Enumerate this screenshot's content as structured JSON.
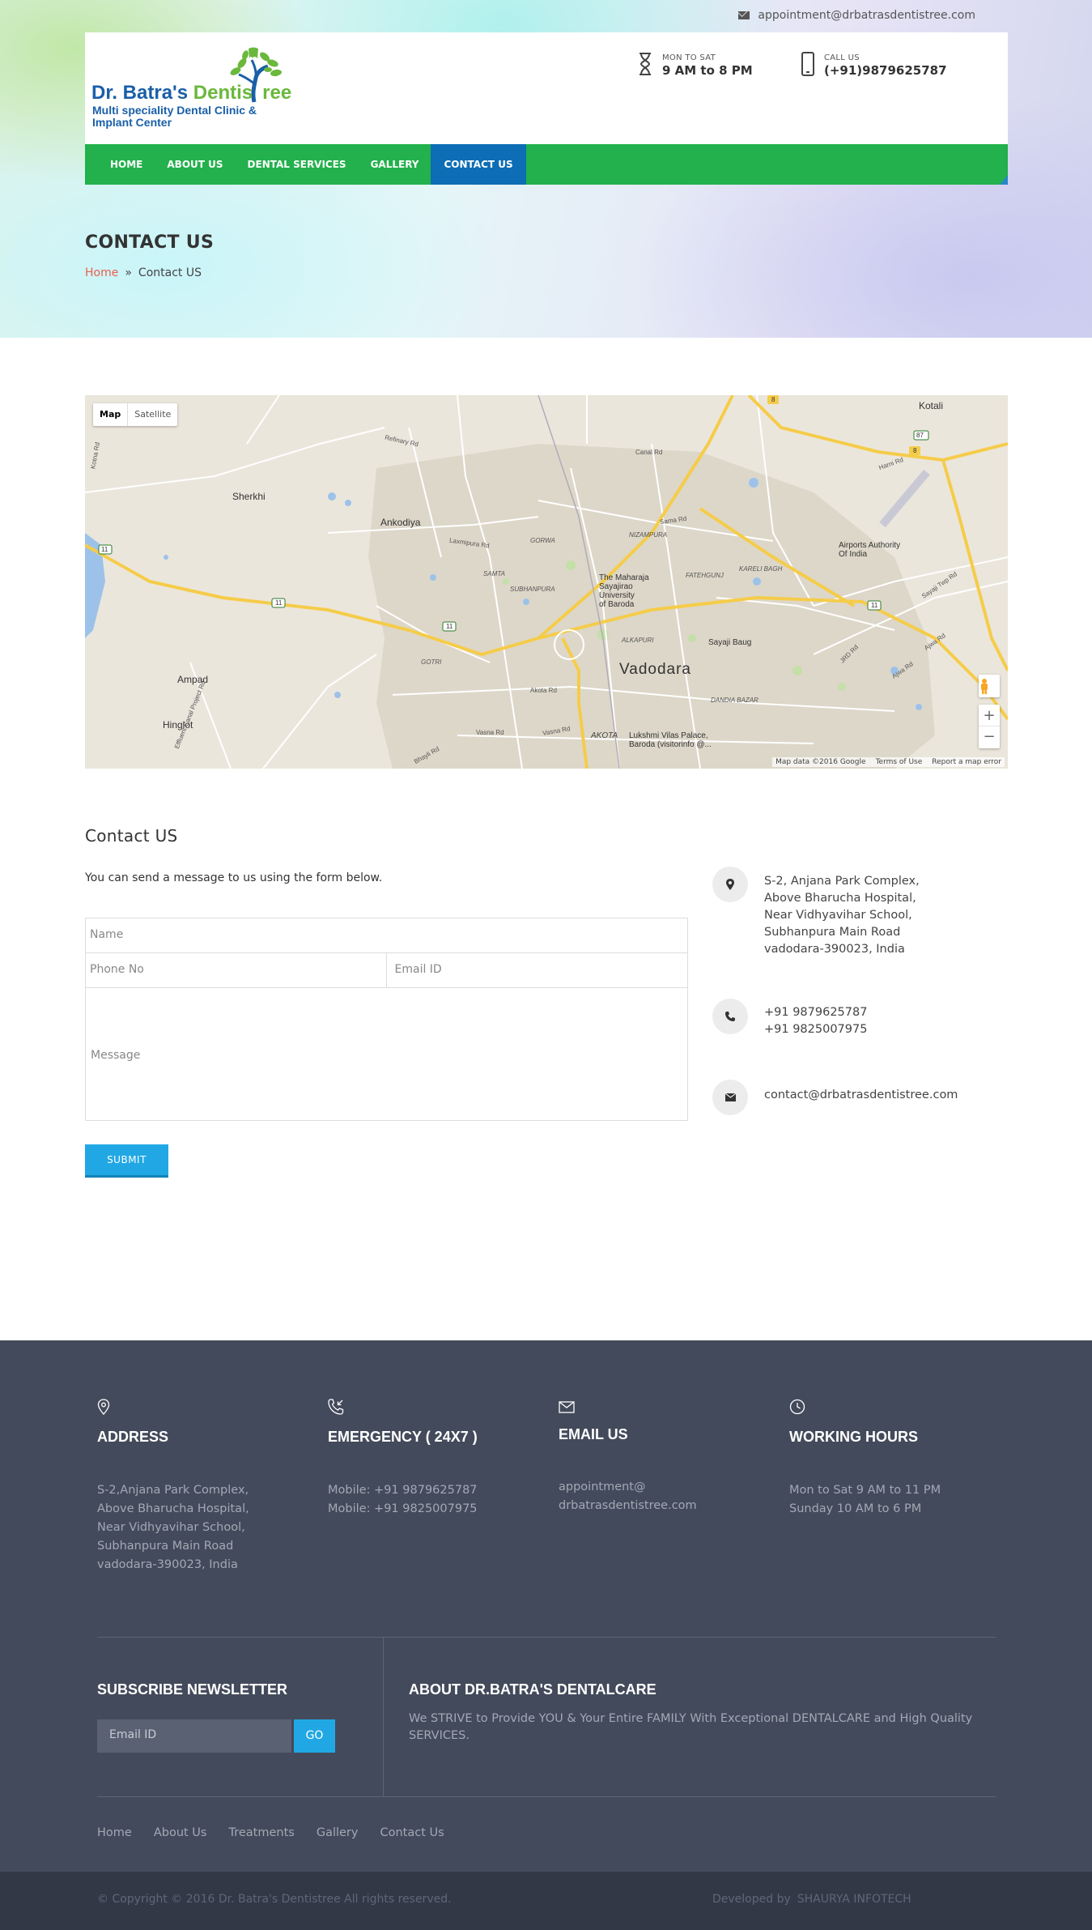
{
  "topbar": {
    "email": "appointment@drbatrasdentistree.com"
  },
  "logo": {
    "name_part1": "Dr. Batra's ",
    "name_part2": "Dentis",
    "name_part3": "ree",
    "subtitle": "Multi speciality Dental Clinic & Implant Center"
  },
  "header_info": {
    "hours_label": "MON TO SAT",
    "hours_value": "9 AM to 8 PM",
    "call_label": "CALL US",
    "call_value": "(+91)9879625787"
  },
  "nav": {
    "items": [
      {
        "label": "HOME"
      },
      {
        "label": "ABOUT US"
      },
      {
        "label": "DENTAL SERVICES"
      },
      {
        "label": "GALLERY"
      },
      {
        "label": "CONTACT US"
      }
    ],
    "active_index": 4
  },
  "page": {
    "title": "CONTACT US",
    "breadcrumb_home": "Home",
    "breadcrumb_sep": "»",
    "breadcrumb_current": "Contact US"
  },
  "map": {
    "toggle_map": "Map",
    "toggle_satellite": "Satellite",
    "zoom_in": "+",
    "zoom_out": "−",
    "attribution": [
      "Map data ©2016 Google",
      "Terms of Use",
      "Report a map error"
    ],
    "labels": {
      "kotali": "Kotali",
      "sherkhi": "Sherkhi",
      "ankodiya": "Ankodiya",
      "ampad": "Ampad",
      "hinglot": "Hinglot",
      "vadodara": "Vadodara",
      "airport": "Airports Authority\nOf India",
      "msu": "The Maharaja\nSayajirao\nUniversity\nof Baroda",
      "sayaji_baug": "Sayaji Baug",
      "lvp": "Lukshmi Vilas Palace,\nBaroda (visitorinfo @...",
      "refinary_rd": "Refinary Rd",
      "canal_rd": "Canal Rd",
      "sama_rd": "Sama Rd",
      "laxmipura_rd": "Laxmipura Rd",
      "akota_rd": "Akota Rd",
      "vasna_rd": "Vasna Rd",
      "vasna_rd2": "Vasna Rd",
      "bhayli_rd": "Bhayli Rd",
      "harni_rd": "Harni Rd",
      "sayaji_twp": "Sayaji Twp Rd",
      "ajwa_rd": "Ajwa Rd",
      "ajwa_rd2": "Ajwa Rd",
      "gorwa": "GORWA",
      "samta": "SAMTA",
      "subhanpura": "SUBHANPURA",
      "nizampura": "NIZAMPURA",
      "fatehgunj": "FATEHGUNJ",
      "karelibagh": "KARELI BAGH",
      "alkapuri": "ALKAPURI",
      "gotri": "GOTRI",
      "dandia_bazar": "DANDIA BAZAR",
      "akota": "AKOTA",
      "effluent_canal": "Effluent Canal Project Rd",
      "kotna_rd": "Kotna Rd",
      "jrd_rd": "JRD Rd",
      "road_11a": "11",
      "road_11b": "11",
      "road_11c": "11",
      "road_11d": "11",
      "road_8a": "8",
      "road_8b": "8",
      "road_87": "87"
    }
  },
  "contact": {
    "title": "Contact US",
    "intro": "You can send a message to us using the form below.",
    "name_placeholder": "Name",
    "phone_placeholder": "Phone No",
    "email_placeholder": "Email ID",
    "message_placeholder": "Message",
    "submit_label": "SUBMIT",
    "address_lines": [
      "S-2, Anjana Park Complex,",
      "Above Bharucha Hospital,",
      "Near Vidhyavihar School,",
      "Subhanpura Main Road",
      "vadodara-390023, India"
    ],
    "phones": [
      "+91 9879625787",
      "+91 9825007975"
    ],
    "email": "contact@drbatrasdentistree.com"
  },
  "footer": {
    "address": {
      "title": "ADDRESS",
      "lines": [
        "S-2,Anjana Park Complex,",
        "Above Bharucha Hospital,",
        "Near Vidhyavihar School,",
        "Subhanpura Main Road",
        "vadodara-390023, India"
      ]
    },
    "emergency": {
      "title": "EMERGENCY ( 24X7 )",
      "lines": [
        "Mobile: +91 9879625787",
        "Mobile: +91 9825007975"
      ]
    },
    "email": {
      "title": "EMAIL US",
      "lines": [
        "appointment@",
        "drbatrasdentistree.com"
      ]
    },
    "hours": {
      "title": "WORKING HOURS",
      "lines": [
        "Mon to Sat 9 AM to 11 PM",
        "Sunday 10 AM to 6 PM"
      ]
    },
    "newsletter": {
      "title": "SUBSCRIBE NEWSLETTER",
      "placeholder": "Email ID",
      "go_label": "GO"
    },
    "about": {
      "title": "ABOUT DR.BATRA'S DENTALCARE",
      "text": "We STRIVE to Provide YOU & Your Entire FAMILY With Exceptional DENTALCARE and High Quality SERVICES."
    },
    "links": [
      {
        "label": "Home"
      },
      {
        "label": "About Us"
      },
      {
        "label": "Treatments"
      },
      {
        "label": "Gallery"
      },
      {
        "label": "Contact Us"
      }
    ],
    "copyright": "© Copyright © 2016 Dr. Batra's Dentistree All rights reserved.",
    "developed_by": "Developed by",
    "developer": "SHAURYA INFOTECH"
  },
  "colors": {
    "nav_green": "#22b14c",
    "nav_active": "#0d6db5",
    "accent_blue": "#21a8e4",
    "breadcrumb_home": "#e8614c",
    "footer_bg": "#434a5b"
  }
}
